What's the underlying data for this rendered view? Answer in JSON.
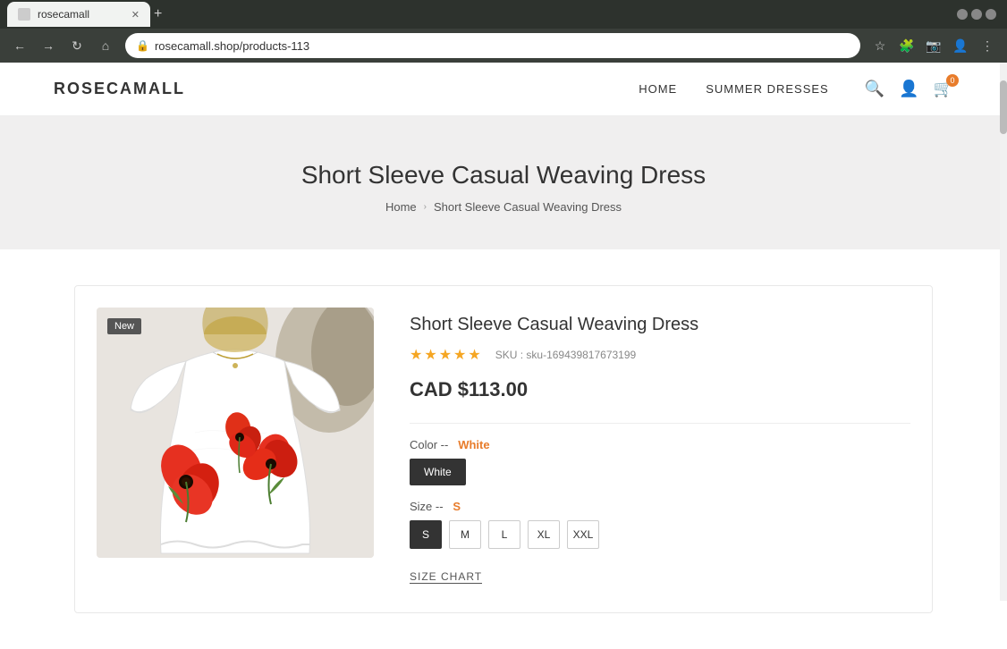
{
  "browser": {
    "tab_title": "rosecamall",
    "url": "rosecamall.shop/products-113",
    "new_tab_icon": "+",
    "controls": {
      "back": "←",
      "forward": "→",
      "reload": "↻",
      "home": "⌂"
    }
  },
  "site": {
    "logo": "ROSECAMALL",
    "nav": [
      {
        "label": "HOME",
        "id": "home"
      },
      {
        "label": "SUMMER DRESSES",
        "id": "summer-dresses"
      }
    ],
    "cart_count": "0"
  },
  "hero": {
    "title": "Short Sleeve Casual Weaving Dress",
    "breadcrumb_home": "Home",
    "breadcrumb_current": "Short Sleeve Casual Weaving Dress"
  },
  "product": {
    "badge": "New",
    "title": "Short Sleeve Casual Weaving Dress",
    "stars": [
      "★",
      "★",
      "★",
      "★",
      "★"
    ],
    "sku_label": "SKU :",
    "sku_value": "sku-169439817673199",
    "price": "CAD $113.00",
    "color_label": "Color --",
    "color_selected": "White",
    "colors": [
      "White"
    ],
    "size_label": "Size --",
    "size_selected": "S",
    "sizes": [
      "S",
      "M",
      "L",
      "XL",
      "XXL"
    ],
    "size_chart_label": "SIZE CHART"
  }
}
